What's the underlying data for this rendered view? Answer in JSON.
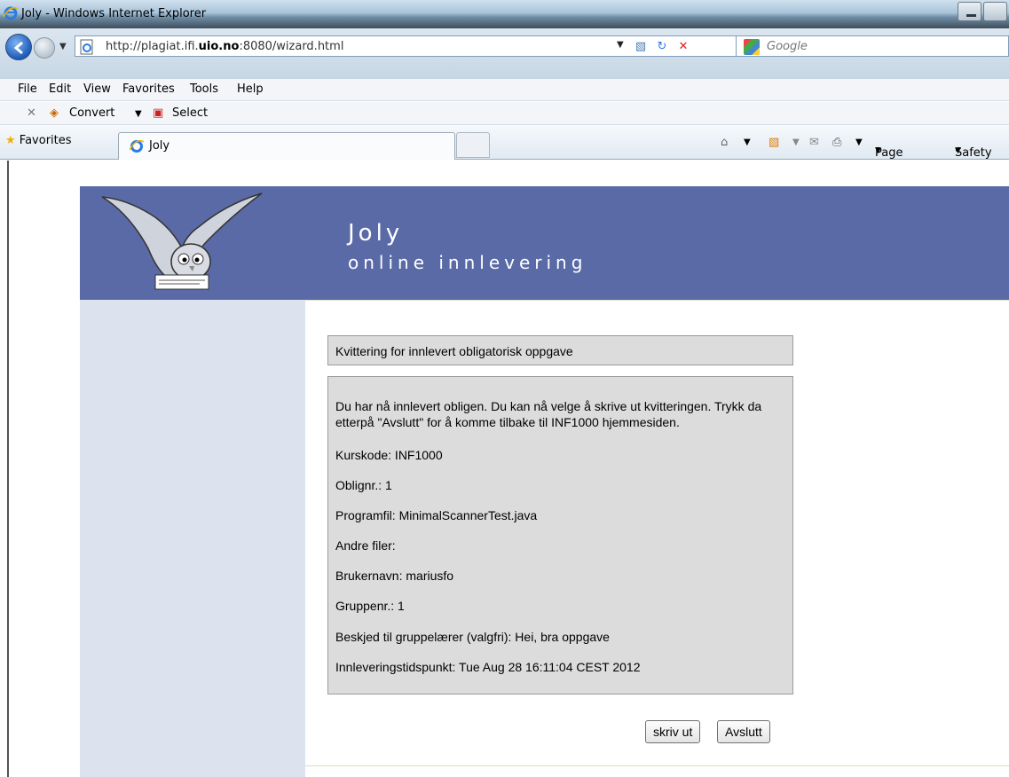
{
  "window": {
    "title": "Joly - Windows Internet Explorer"
  },
  "address": {
    "url_prefix": "http://plagiat.ifi.",
    "url_bold": "uio.no",
    "url_suffix": ":8080/wizard.html"
  },
  "search": {
    "placeholder": "Google"
  },
  "menu": [
    "File",
    "Edit",
    "View",
    "Favorites",
    "Tools",
    "Help"
  ],
  "convert_toolbar": {
    "convert_label": "Convert",
    "select_label": "Select"
  },
  "favorites_bar": {
    "favorites_label": "Favorites",
    "tab_title": "Joly",
    "page_label": "Page",
    "safety_label": "Safety"
  },
  "banner": {
    "title": "Joly",
    "subtitle": "online innlevering"
  },
  "receipt": {
    "heading": "Kvittering for innlevert obligatorisk oppgave",
    "intro": "Du har nå innlevert obligen. Du kan nå velge å skrive ut kvitteringen. Trykk da etterpå \"Avslutt\" for å komme tilbake til INF1000 hjemmesiden.",
    "kurskode": "Kurskode: INF1000",
    "oblignr": "Oblignr.: 1",
    "programfil": "Programfil: MinimalScannerTest.java",
    "andre_filer": "Andre filer:",
    "brukernavn": "Brukernavn: mariusfo",
    "gruppenr": "Gruppenr.: 1",
    "beskjed": "Beskjed til gruppelærer (valgfri): Hei, bra oppgave",
    "tidspunkt": "Innleveringstidspunkt: Tue Aug 28 16:11:04 CEST 2012"
  },
  "buttons": {
    "print": "skriv ut",
    "finish": "Avslutt"
  }
}
